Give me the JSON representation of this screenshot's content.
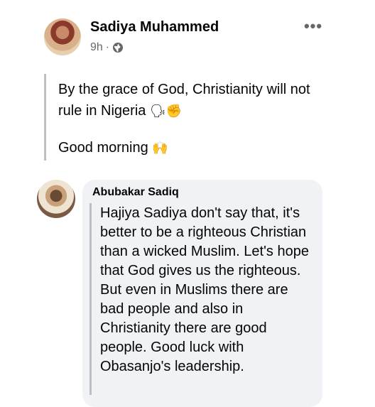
{
  "post": {
    "author_name": "Sadiya Muhammed",
    "time": "9h",
    "meta_separator": "·",
    "more_label": "•••",
    "text": "By the grace of God, Christianity will not rule in Nigeria",
    "text_emoji": "🗣✊",
    "greeting": "Good morning",
    "greeting_emoji": "🙌"
  },
  "comment": {
    "author_name": "Abubakar Sadiq",
    "text": "Hajiya Sadiya don't say that, it's better to be a righteous Christian than a wicked Muslim. Let's hope that God gives us the righteous. But even in Muslims there are bad people and also in Christianity there are good people. Good luck with Obasanjo's leadership."
  },
  "icons": {
    "privacy": "globe-icon",
    "menu": "more-icon"
  }
}
